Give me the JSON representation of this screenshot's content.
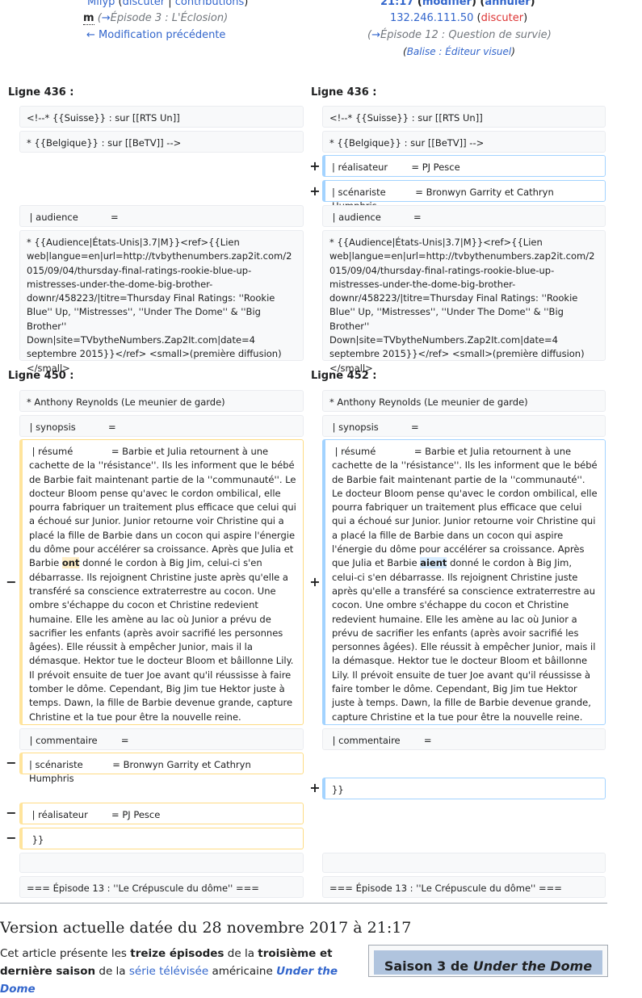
{
  "header": {
    "left_user": "Milyp",
    "left_talk": "discuter",
    "left_contrib": "contributions",
    "left_minor": "m",
    "left_summary_arrow": "→",
    "left_summary": "Épisode 3 : L'Éclosion",
    "prev_edit": "← Modification précédente",
    "right_time": "21:17",
    "right_modify": "modifier",
    "right_undo": "annuler",
    "right_ip": "132.246.111.50",
    "right_talk": "discuter",
    "right_summary_arrow": "→",
    "right_summary": "Épisode 12 : Question de survie",
    "tag_label": "Balise :",
    "tag_value": "Éditeur visuel"
  },
  "diff": {
    "ligne_a_left": "Ligne 436 :",
    "ligne_a_right": "Ligne 436 :",
    "ligne_b_left": "Ligne 450 :",
    "ligne_b_right": "Ligne 452 :",
    "suisse": "<!--* {{Suisse}} : sur [[RTS Un]]",
    "belgique": "* {{Belgique}} : sur [[BeTV]] -->",
    "realisateur_add": "| réalisateur        = PJ Pesce",
    "scenariste_add": "| scénariste          = Bronwyn Garrity et Cathryn Humphris",
    "audience": " | audience           =",
    "audience_ref": "* {{Audience|États-Unis|3.7|M}}<ref>{{Lien web|langue=en|url=http://tvbythenumbers.zap2it.com/2015/09/04/thursday-final-ratings-rookie-blue-up-mistresses-under-the-dome-big-brother-downr/458223/|titre=Thursday Final Ratings: ''Rookie Blue'' Up, ''Mistresses'', ''Under The Dome'' & ''Big Brother'' Down|site=TVbytheNumbers.Zap2It.com|date=4 septembre 2015}}</ref> <small>(première diffusion)</small>",
    "anthony": "* Anthony Reynolds (Le meunier de garde)",
    "synopsis": " | synopsis           =",
    "resume_before": " | résumé             = Barbie et Julia retournent à une cachette de la ''résistance''. Ils les informent que le bébé de Barbie fait maintenant partie de la ''communauté''. Le docteur Bloom pense qu'avec le cordon ombilical, elle pourra fabriquer un traitement plus efficace que celui qui a échoué sur Junior. Junior retourne voir Christine qui a placé la fille de Barbie dans un cocon qui aspire l'énergie du dôme pour accélérer sa croissance. Après que Julia et Barbie ",
    "resume_word_old": "ont",
    "resume_word_new": "aient",
    "resume_after": " donné le cordon à Big Jim, celui-ci s'en débarrasse. Ils rejoignent Christine juste après qu'elle a transféré sa conscience extraterrestre au cocon. Une ombre s'échappe du cocon et Christine redevient humaine. Elle les amène au lac où Junior a prévu de sacrifier les enfants (après avoir sacrifié les personnes âgées). Elle réussit à empêcher Junior, mais il la démasque. Hektor tue le docteur Bloom et bâillonne Lily. Il prévoit ensuite de tuer Joe avant qu'il réussisse à faire tomber le dôme. Cependant, Big Jim tue Hektor juste à temps. Dawn, la fille de Barbie devenue grande, capture Christine et la tue pour être la nouvelle reine.",
    "commentaire": " | commentaire        =",
    "scenariste_del": "| scénariste          = Bronwyn Garrity et Cathryn Humphris",
    "close_add": "}}",
    "realisateur_del": " | réalisateur        = PJ Pesce",
    "close_del": " }}",
    "episode13": "=== Épisode 13 : ''Le Crépuscule du dôme'' ===",
    "minus": "−",
    "plus": "+"
  },
  "footer": {
    "version_title": "Version actuelle datée du 28 novembre 2017 à 21:17",
    "intro_1": "Cet article présente les ",
    "intro_b1": "treize épisodes",
    "intro_2": " de la ",
    "intro_b2": "troisième et dernière saison",
    "intro_3": " de la ",
    "intro_link1": "série télévisée",
    "intro_4": " américaine ",
    "intro_link2": "Under the Dome",
    "infobox_title_1": "Saison 3 de ",
    "infobox_title_2": "Under the Dome"
  }
}
